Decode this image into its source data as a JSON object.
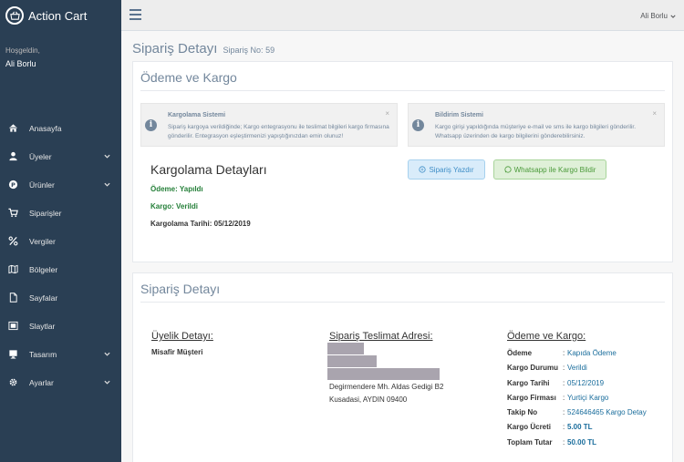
{
  "app": {
    "name": "Action Cart"
  },
  "profile": {
    "welcome": "Hoşgeldin,",
    "name": "Ali Borlu"
  },
  "menu": [
    {
      "label": "Anasayfa",
      "icon": "home-icon",
      "has_children": false
    },
    {
      "label": "Üyeler",
      "icon": "user-icon",
      "has_children": true
    },
    {
      "label": "Ürünler",
      "icon": "product-icon",
      "has_children": true
    },
    {
      "label": "Siparişler",
      "icon": "cart-icon",
      "has_children": false
    },
    {
      "label": "Vergiler",
      "icon": "percent-icon",
      "has_children": false
    },
    {
      "label": "Bölgeler",
      "icon": "map-icon",
      "has_children": false
    },
    {
      "label": "Sayfalar",
      "icon": "page-icon",
      "has_children": false
    },
    {
      "label": "Slaytlar",
      "icon": "slides-icon",
      "has_children": false
    },
    {
      "label": "Tasarım",
      "icon": "design-icon",
      "has_children": true
    },
    {
      "label": "Ayarlar",
      "icon": "settings-icon",
      "has_children": true
    }
  ],
  "topbar": {
    "user": "Ali Borlu"
  },
  "page": {
    "title": "Sipariş Detayı",
    "subtitle": "Sipariş No: 59"
  },
  "shipping_panel": {
    "title": "Ödeme ve Kargo",
    "alert1": {
      "title": "Kargolama Sistemi",
      "text": "Sipariş kargoya verildiğinde; Kargo entegrasyonu ile teslimat bilgileri kargo firmasına gönderilir. Entegrasyon eşleştirmenizi yapıştığınızdan emin olunuz!"
    },
    "alert2": {
      "title": "Bildirim Sistemi",
      "text": "Kargo girişi yapıldığında müşteriye e-mail ve sms ile kargo bilgileri gönderilir. Whatsapp üzerinden de kargo bilgilerini gönderebilirsiniz."
    },
    "details_title": "Kargolama Detayları",
    "payment_status": "Ödeme: Yapıldı",
    "cargo_status": "Kargo: Verildi",
    "cargo_date": "Kargolama Tarihi: 05/12/2019",
    "print_button": "Sipariş Yazdır",
    "whatsapp_button": "Whatsapp ile Kargo Bildir"
  },
  "order_panel": {
    "title": "Sipariş Detayı",
    "member": {
      "title": "Üyelik Detayı:",
      "value": "Misafir Müşteri"
    },
    "address": {
      "title": "Sipariş Teslimat Adresi:",
      "line1": "Degirmendere Mh. Aldas Gedigi B2",
      "line2": "Kusadasi, AYDIN 09400"
    },
    "payment": {
      "title": "Ödeme ve Kargo:",
      "rows": [
        {
          "key": "Ödeme",
          "value": "Kapıda Ödeme"
        },
        {
          "key": "Kargo Durumu",
          "value": "Verildi"
        },
        {
          "key": "Kargo Tarihi",
          "value": "05/12/2019"
        },
        {
          "key": "Kargo Firması",
          "value": "Yurtiçi Kargo"
        },
        {
          "key": "Takip No",
          "value": "524646465 Kargo Detay"
        },
        {
          "key": "Kargo Ücreti",
          "value": "5.00 TL"
        },
        {
          "key": "Toplam Tutar",
          "value": "50.00 TL"
        }
      ]
    }
  },
  "colors": {
    "sidebar": "#2a3f54",
    "accent_green": "#26803a",
    "link_blue": "#1a6d9c"
  }
}
